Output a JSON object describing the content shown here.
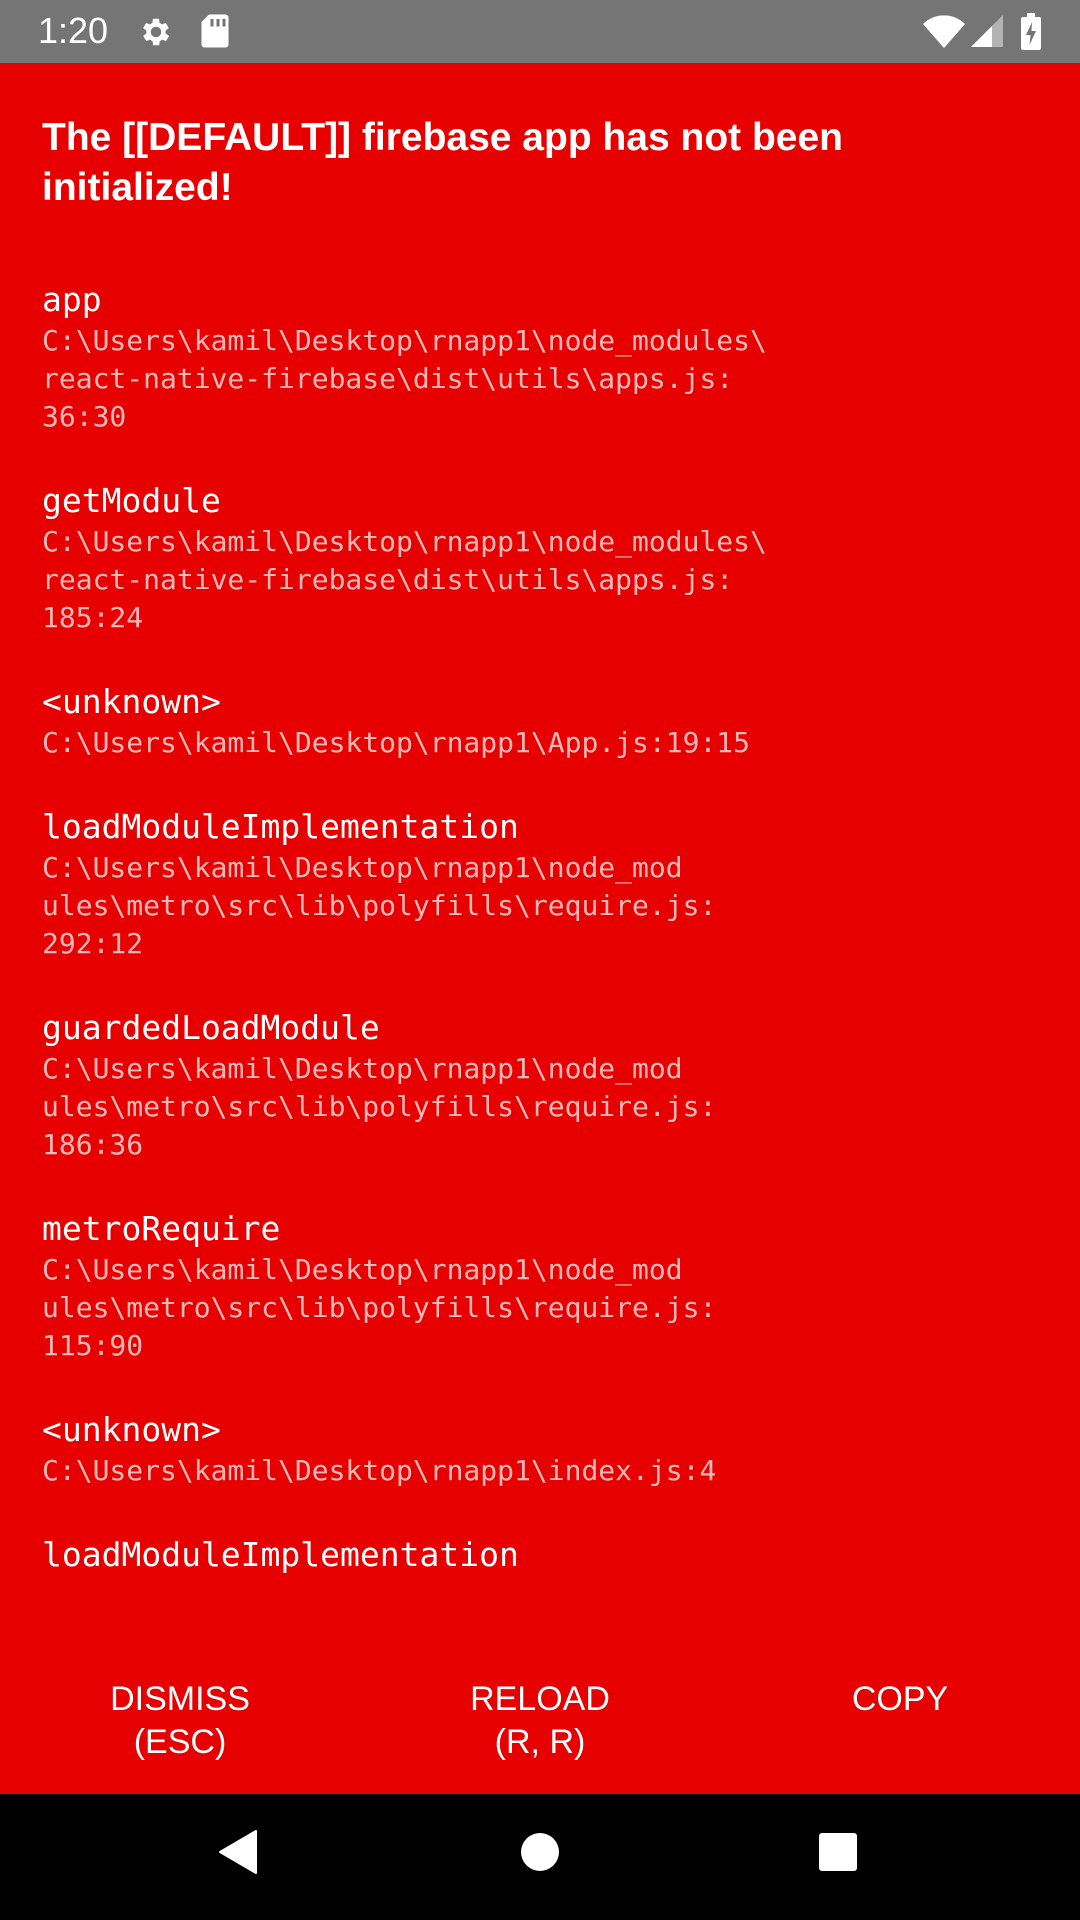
{
  "status_bar": {
    "time": "1:20",
    "icons": [
      "gear-icon",
      "sd-card-icon",
      "wifi-icon",
      "signal-icon",
      "battery-charging-icon"
    ]
  },
  "error": {
    "title": "The [[DEFAULT]] firebase app has not been initialized!"
  },
  "stack": [
    {
      "method": "app",
      "location": "C:\\Users\\kamil\\Desktop\\rnapp1\\node_modules\\\nreact-native-firebase\\dist\\utils\\apps.js:\n36:30"
    },
    {
      "method": "getModule",
      "location": "C:\\Users\\kamil\\Desktop\\rnapp1\\node_modules\\\nreact-native-firebase\\dist\\utils\\apps.js:\n185:24"
    },
    {
      "method": "<unknown>",
      "location": "C:\\Users\\kamil\\Desktop\\rnapp1\\App.js:19:15"
    },
    {
      "method": "loadModuleImplementation",
      "location": "C:\\Users\\kamil\\Desktop\\rnapp1\\node_mod\nules\\metro\\src\\lib\\polyfills\\require.js:\n292:12"
    },
    {
      "method": "guardedLoadModule",
      "location": "C:\\Users\\kamil\\Desktop\\rnapp1\\node_mod\nules\\metro\\src\\lib\\polyfills\\require.js:\n186:36"
    },
    {
      "method": "metroRequire",
      "location": "C:\\Users\\kamil\\Desktop\\rnapp1\\node_mod\nules\\metro\\src\\lib\\polyfills\\require.js:\n115:90"
    },
    {
      "method": "<unknown>",
      "location": "C:\\Users\\kamil\\Desktop\\rnapp1\\index.js:4"
    },
    {
      "method": "loadModuleImplementation",
      "location": ""
    }
  ],
  "buttons": {
    "dismiss": {
      "line1": "DISMISS",
      "line2": "(ESC)"
    },
    "reload": {
      "line1": "RELOAD",
      "line2": "(R, R)"
    },
    "copy": {
      "line1": "COPY",
      "line2": ""
    }
  },
  "nav_bar": {
    "icons": [
      "back-icon",
      "home-icon",
      "recents-icon"
    ]
  },
  "colors": {
    "redbox_background": "#e60000",
    "status_bar": "#757575",
    "nav_bar": "#000000"
  }
}
